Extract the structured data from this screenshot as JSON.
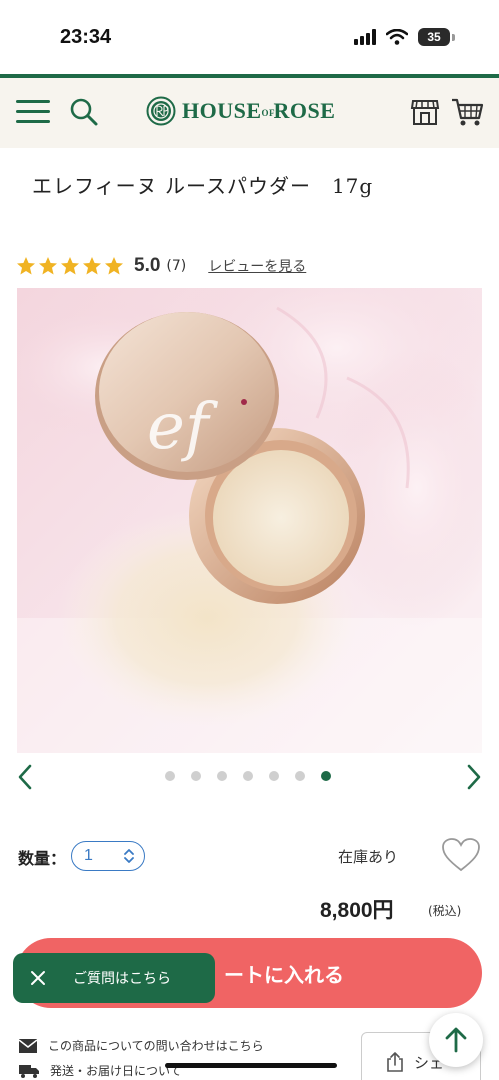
{
  "status_bar": {
    "time": "23:34",
    "battery": "35"
  },
  "header": {
    "logo_text": "HOUSE of ROSE",
    "logo_brand_left": "HOUSE",
    "logo_brand_of": "OF",
    "logo_brand_right": "ROSE"
  },
  "product": {
    "title": "エレフィーヌ ルースパウダー　17g",
    "rating": "5.0",
    "review_count": "(7)",
    "review_link": "レビューを見る",
    "stars": 5,
    "image_monogram": "ef"
  },
  "carousel": {
    "dot_count": 7,
    "active_index": 6
  },
  "purchase": {
    "qty_label": "数量：",
    "qty_value": "1",
    "stock": "在庫あり",
    "price": "8,800円",
    "tax": "(税込)",
    "cart_button": "ートに入れる"
  },
  "faq_chip": {
    "label": "ご質問はこちら"
  },
  "footer_links": {
    "contact": "この商品についての問い合わせはこちら",
    "shipping": "発送・お届け日について",
    "share": "シェ"
  },
  "colors": {
    "brand_green": "#1e6a47",
    "cta_red": "#f06464",
    "star_gold": "#f0b323",
    "select_blue": "#3a7ac4"
  }
}
